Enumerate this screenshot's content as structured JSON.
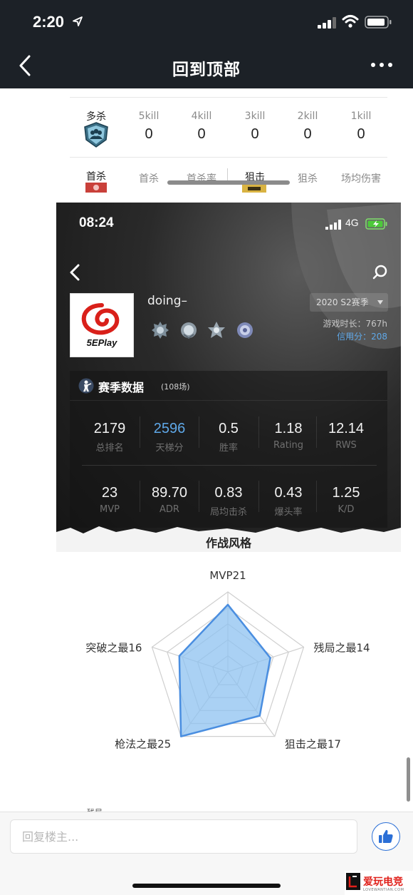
{
  "status_bar": {
    "time": "2:20"
  },
  "nav": {
    "title": "回到顶部"
  },
  "kill_table": {
    "multi_kill": {
      "label": "多杀",
      "columns": [
        {
          "label": "5kill",
          "value": "0"
        },
        {
          "label": "4kill",
          "value": "0"
        },
        {
          "label": "3kill",
          "value": "0"
        },
        {
          "label": "2kill",
          "value": "0"
        },
        {
          "label": "1kill",
          "value": "0"
        }
      ]
    },
    "first_kill": {
      "label": "首杀",
      "columns": [
        "首杀",
        "首杀率",
        "狙击",
        "狙杀",
        "场均伤害"
      ]
    }
  },
  "embedded": {
    "time": "08:24",
    "network": "4G",
    "logo_text": "5EPlay",
    "username": "doing–",
    "season": "2020 S2赛季",
    "play_time_label": "游戏时长：",
    "play_time": "767h",
    "credit_label": "信用分：",
    "credit": "208",
    "section_title": "赛季数据",
    "match_count": "(108场)",
    "stats_row1": [
      {
        "value": "2179",
        "label": "总排名"
      },
      {
        "value": "2596",
        "label": "天梯分"
      },
      {
        "value": "0.5",
        "label": "胜率"
      },
      {
        "value": "1.18",
        "label": "Rating"
      },
      {
        "value": "12.14",
        "label": "RWS"
      }
    ],
    "stats_row2": [
      {
        "value": "23",
        "label": "MVP"
      },
      {
        "value": "89.70",
        "label": "ADR"
      },
      {
        "value": "0.83",
        "label": "局均击杀"
      },
      {
        "value": "0.43",
        "label": "爆头率"
      },
      {
        "value": "1.25",
        "label": "K/D"
      }
    ],
    "style_title": "作战风格"
  },
  "chart_data": {
    "type": "radar",
    "axes": [
      "MVP",
      "残局之最",
      "狙击之最",
      "枪法之最",
      "突破之最"
    ],
    "values": [
      21,
      14,
      17,
      25,
      16
    ],
    "labels": [
      "MVP21",
      "残局之最14",
      "狙击之最17",
      "枪法之最25",
      "突破之最16"
    ],
    "max": 25,
    "rings": 5,
    "fill_color": "#8ec2f0",
    "line_color": "#4a8ee0"
  },
  "bottom": {
    "cut_text": "残局",
    "reply_placeholder": "回复楼主...",
    "watermark": "爱玩电竞",
    "watermark_sub": "LOVEWANTIAN.COM"
  },
  "colors": {
    "accent_blue": "#5fa8e8",
    "like_blue": "#2b6fd6",
    "topbar": "#1c2127"
  }
}
